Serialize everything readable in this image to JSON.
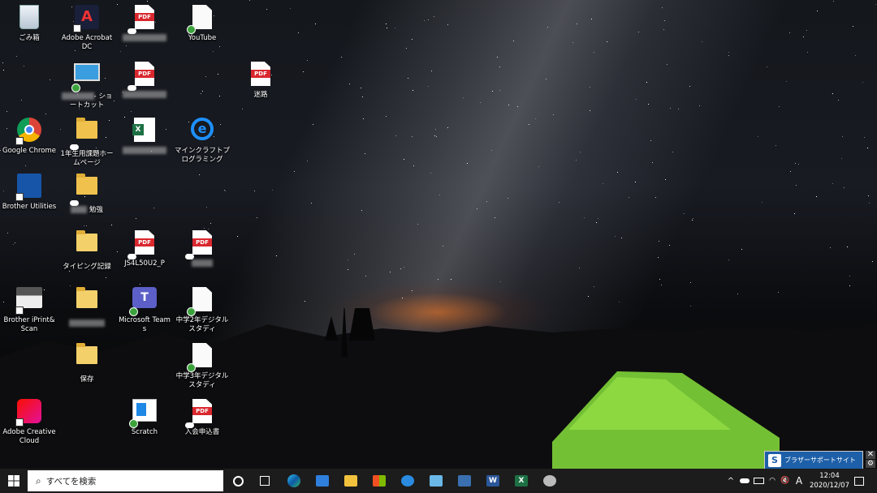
{
  "desktop": {
    "icons": [
      {
        "id": "recycle",
        "label": "ごみ箱",
        "icon": "recycle-bin-icon"
      },
      {
        "id": "acrobat",
        "label": "Adobe Acrobat DC",
        "icon": "adobe-acrobat-icon"
      },
      {
        "id": "pdf1",
        "label": "",
        "icon": "pdf-icon"
      },
      {
        "id": "youtube",
        "label": "YouTube",
        "icon": "document-icon"
      },
      {
        "id": "shortcut",
        "label": "- ショートカット",
        "icon": "computer-shortcut-icon"
      },
      {
        "id": "pdf2",
        "label": "",
        "icon": "pdf-icon"
      },
      {
        "id": "meiro",
        "label": "迷路",
        "icon": "pdf-icon"
      },
      {
        "id": "chrome",
        "label": "Google Chrome",
        "icon": "chrome-icon"
      },
      {
        "id": "homepage",
        "label": "1年生用課題ホームページ",
        "icon": "folder-icon"
      },
      {
        "id": "excel",
        "label": "",
        "icon": "excel-file-icon"
      },
      {
        "id": "minecraft",
        "label": "マインクラフトプログラミング",
        "icon": "internet-explorer-icon"
      },
      {
        "id": "brother-util",
        "label": "Brother Utilities",
        "icon": "brother-utilities-icon"
      },
      {
        "id": "benkyo",
        "label": "勉強",
        "icon": "folder-icon"
      },
      {
        "id": "typing",
        "label": "タイピング記録",
        "icon": "folder-icon"
      },
      {
        "id": "js4",
        "label": "JS4L50U2_P",
        "icon": "pdf-icon"
      },
      {
        "id": "pdf3",
        "label": "",
        "icon": "pdf-icon"
      },
      {
        "id": "iprint",
        "label": "Brother iPrint&Scan",
        "icon": "brother-iprint-icon"
      },
      {
        "id": "folder4",
        "label": "",
        "icon": "folder-icon"
      },
      {
        "id": "teams",
        "label": "Microsoft Teams",
        "icon": "teams-icon"
      },
      {
        "id": "ds2",
        "label": "中学2年デジタルスタディ",
        "icon": "document-icon"
      },
      {
        "id": "hozon",
        "label": "保存",
        "icon": "folder-icon"
      },
      {
        "id": "ds3",
        "label": "中学3年デジタルスタディ",
        "icon": "document-icon"
      },
      {
        "id": "adobecc",
        "label": "Adobe Creative Cloud",
        "icon": "adobe-cc-icon"
      },
      {
        "id": "scratch",
        "label": "Scratch",
        "icon": "scratch-icon"
      },
      {
        "id": "nyukai",
        "label": "入会申込書",
        "icon": "pdf-icon"
      }
    ],
    "badge": {
      "label": "ブラザーサポートサイト"
    }
  },
  "taskbar": {
    "start_icon": "windows-start-icon",
    "search_placeholder": "すべてを検索",
    "apps": [
      "cortana-icon",
      "task-view-icon",
      "edge-icon",
      "mail-icon",
      "file-explorer-icon",
      "store-icon",
      "safari-like-icon",
      "remote-desktop-icon",
      "device-icon",
      "word-icon",
      "excel-icon",
      "snipping-icon"
    ],
    "tray": {
      "ime": "A",
      "time": "12:04",
      "date": "2020/12/07"
    }
  }
}
